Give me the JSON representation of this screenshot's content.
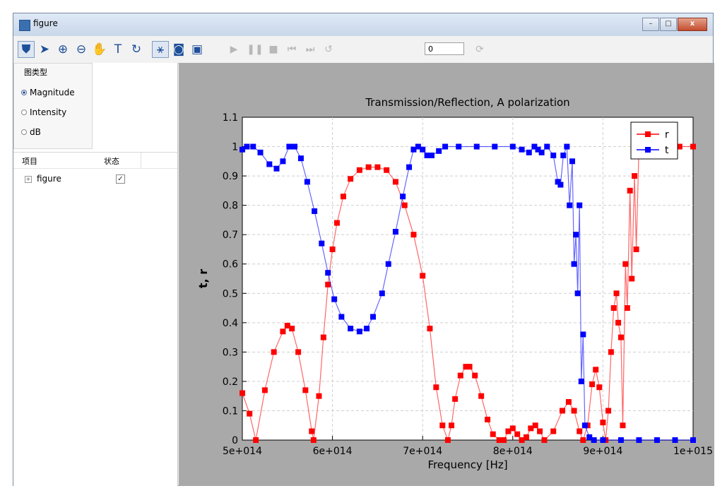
{
  "window": {
    "title": "figure",
    "buttons": {
      "minimize": "–",
      "maximize": "□",
      "close": "x"
    }
  },
  "toolbar": {
    "tools": [
      {
        "name": "select-mode-icon",
        "glyph": "⛊",
        "selected": true,
        "enabled": true
      },
      {
        "name": "pointer-icon",
        "glyph": "➤",
        "selected": false,
        "enabled": true
      },
      {
        "name": "zoom-in-icon",
        "glyph": "⊕",
        "selected": false,
        "enabled": true
      },
      {
        "name": "zoom-out-icon",
        "glyph": "⊖",
        "selected": false,
        "enabled": true
      },
      {
        "name": "pan-hand-icon",
        "glyph": "✋",
        "selected": false,
        "enabled": true
      },
      {
        "name": "text-tool-icon",
        "glyph": "T",
        "selected": false,
        "enabled": true
      },
      {
        "name": "rotate-icon",
        "glyph": "↻",
        "selected": false,
        "enabled": true
      },
      {
        "name": "data-cursor-icon",
        "glyph": "⚹",
        "selected": true,
        "enabled": true
      },
      {
        "name": "camera-icon",
        "glyph": "◙",
        "selected": false,
        "enabled": true
      },
      {
        "name": "export-icon",
        "glyph": "▣",
        "selected": false,
        "enabled": true
      },
      {
        "name": "play-icon",
        "glyph": "▶",
        "selected": false,
        "enabled": false
      },
      {
        "name": "pause-icon",
        "glyph": "❚❚",
        "selected": false,
        "enabled": false
      },
      {
        "name": "stop-icon",
        "glyph": "■",
        "selected": false,
        "enabled": false
      },
      {
        "name": "first-frame-icon",
        "glyph": "⏮",
        "selected": false,
        "enabled": false
      },
      {
        "name": "last-frame-icon",
        "glyph": "⏭",
        "selected": false,
        "enabled": false
      },
      {
        "name": "loop-icon",
        "glyph": "↺",
        "selected": false,
        "enabled": false
      }
    ],
    "frame_value": "0",
    "refresh_icon": "⟳"
  },
  "panel": {
    "plot_type_title": "图类型",
    "options": [
      {
        "label": "Magnitude",
        "selected": true
      },
      {
        "label": "Intensity",
        "selected": false
      },
      {
        "label": "dB",
        "selected": false
      }
    ],
    "tree_headers": {
      "item": "项目",
      "status": "状态"
    },
    "tree_rows": [
      {
        "label": "figure",
        "checked": true
      }
    ]
  },
  "colors": {
    "r": "#ff0000",
    "t": "#0000ff",
    "plot_bg": "#a9a9a9"
  },
  "chart_data": {
    "type": "scatter",
    "title": "Transmission/Reflection, A polarization",
    "xlabel": "Frequency [Hz]",
    "ylabel": "t, r",
    "xlim": [
      500000000000000.0,
      1000000000000000.0
    ],
    "ylim": [
      0,
      1.1
    ],
    "xticks": [
      "5e+014",
      "6e+014",
      "7e+014",
      "8e+014",
      "9e+014",
      "1e+015"
    ],
    "yticks": [
      "0",
      "0.1",
      "0.2",
      "0.3",
      "0.4",
      "0.5",
      "0.6",
      "0.7",
      "0.8",
      "0.9",
      "1",
      "1.1"
    ],
    "grid": true,
    "legend": "top-right",
    "series": [
      {
        "name": "r",
        "color": "#ff0000",
        "points": [
          [
            500000000000000.0,
            0.16
          ],
          [
            508000000000000.0,
            0.09
          ],
          [
            515000000000000.0,
            0.0
          ],
          [
            525000000000000.0,
            0.17
          ],
          [
            535000000000000.0,
            0.3
          ],
          [
            545000000000000.0,
            0.37
          ],
          [
            550000000000000.0,
            0.39
          ],
          [
            555000000000000.0,
            0.38
          ],
          [
            562000000000000.0,
            0.3
          ],
          [
            570000000000000.0,
            0.17
          ],
          [
            577000000000000.0,
            0.03
          ],
          [
            579000000000000.0,
            0.0
          ],
          [
            585000000000000.0,
            0.15
          ],
          [
            590000000000000.0,
            0.35
          ],
          [
            595000000000000.0,
            0.53
          ],
          [
            600000000000000.0,
            0.65
          ],
          [
            605000000000000.0,
            0.74
          ],
          [
            612000000000000.0,
            0.83
          ],
          [
            620000000000000.0,
            0.89
          ],
          [
            630000000000000.0,
            0.92
          ],
          [
            640000000000000.0,
            0.93
          ],
          [
            650000000000000.0,
            0.93
          ],
          [
            660000000000000.0,
            0.92
          ],
          [
            670000000000000.0,
            0.88
          ],
          [
            680000000000000.0,
            0.8
          ],
          [
            690000000000000.0,
            0.7
          ],
          [
            700000000000000.0,
            0.56
          ],
          [
            708000000000000.0,
            0.38
          ],
          [
            715000000000000.0,
            0.18
          ],
          [
            722000000000000.0,
            0.05
          ],
          [
            728000000000000.0,
            0.0
          ],
          [
            732000000000000.0,
            0.05
          ],
          [
            736000000000000.0,
            0.14
          ],
          [
            742000000000000.0,
            0.22
          ],
          [
            748000000000000.0,
            0.25
          ],
          [
            752000000000000.0,
            0.25
          ],
          [
            758000000000000.0,
            0.22
          ],
          [
            765000000000000.0,
            0.15
          ],
          [
            772000000000000.0,
            0.07
          ],
          [
            778000000000000.0,
            0.02
          ],
          [
            785000000000000.0,
            0.0
          ],
          [
            790000000000000.0,
            0.0
          ],
          [
            795000000000000.0,
            0.03
          ],
          [
            800000000000000.0,
            0.04
          ],
          [
            805000000000000.0,
            0.02
          ],
          [
            810000000000000.0,
            0.0
          ],
          [
            815000000000000.0,
            0.01
          ],
          [
            820000000000000.0,
            0.04
          ],
          [
            825000000000000.0,
            0.05
          ],
          [
            830000000000000.0,
            0.03
          ],
          [
            835000000000000.0,
            0.0
          ],
          [
            845000000000000.0,
            0.03
          ],
          [
            855000000000000.0,
            0.1
          ],
          [
            862000000000000.0,
            0.13
          ],
          [
            868000000000000.0,
            0.1
          ],
          [
            874000000000000.0,
            0.03
          ],
          [
            878000000000000.0,
            0.0
          ],
          [
            883000000000000.0,
            0.05
          ],
          [
            888000000000000.0,
            0.19
          ],
          [
            892000000000000.0,
            0.24
          ],
          [
            896000000000000.0,
            0.18
          ],
          [
            900000000000000.0,
            0.06
          ],
          [
            903000000000000.0,
            0.0
          ],
          [
            906000000000000.0,
            0.1
          ],
          [
            909000000000000.0,
            0.3
          ],
          [
            912000000000000.0,
            0.45
          ],
          [
            915000000000000.0,
            0.5
          ],
          [
            917000000000000.0,
            0.4
          ],
          [
            920000000000000.0,
            0.35
          ],
          [
            922000000000000.0,
            0.05
          ],
          [
            925000000000000.0,
            0.6
          ],
          [
            927000000000000.0,
            0.45
          ],
          [
            930000000000000.0,
            0.85
          ],
          [
            932000000000000.0,
            0.55
          ],
          [
            935000000000000.0,
            0.9
          ],
          [
            937000000000000.0,
            0.65
          ],
          [
            940000000000000.0,
            1.0
          ],
          [
            945000000000000.0,
            1.0
          ],
          [
            955000000000000.0,
            1.0
          ],
          [
            970000000000000.0,
            1.0
          ],
          [
            985000000000000.0,
            1.0
          ],
          [
            1000000000000000.0,
            1.0
          ]
        ]
      },
      {
        "name": "t",
        "color": "#0000ff",
        "points": [
          [
            500000000000000.0,
            0.99
          ],
          [
            505000000000000.0,
            1.0
          ],
          [
            512000000000000.0,
            1.0
          ],
          [
            520000000000000.0,
            0.98
          ],
          [
            530000000000000.0,
            0.94
          ],
          [
            538000000000000.0,
            0.925
          ],
          [
            545000000000000.0,
            0.95
          ],
          [
            552000000000000.0,
            1.0
          ],
          [
            558000000000000.0,
            1.0
          ],
          [
            565000000000000.0,
            0.96
          ],
          [
            572000000000000.0,
            0.88
          ],
          [
            580000000000000.0,
            0.78
          ],
          [
            588000000000000.0,
            0.67
          ],
          [
            595000000000000.0,
            0.57
          ],
          [
            602000000000000.0,
            0.48
          ],
          [
            610000000000000.0,
            0.42
          ],
          [
            620000000000000.0,
            0.38
          ],
          [
            630000000000000.0,
            0.37
          ],
          [
            638000000000000.0,
            0.38
          ],
          [
            645000000000000.0,
            0.42
          ],
          [
            655000000000000.0,
            0.5
          ],
          [
            662000000000000.0,
            0.6
          ],
          [
            670000000000000.0,
            0.71
          ],
          [
            678000000000000.0,
            0.83
          ],
          [
            685000000000000.0,
            0.93
          ],
          [
            690000000000000.0,
            0.99
          ],
          [
            695000000000000.0,
            1.0
          ],
          [
            700000000000000.0,
            0.99
          ],
          [
            705000000000000.0,
            0.97
          ],
          [
            710000000000000.0,
            0.97
          ],
          [
            718000000000000.0,
            0.985
          ],
          [
            725000000000000.0,
            1.0
          ],
          [
            740000000000000.0,
            1.0
          ],
          [
            760000000000000.0,
            1.0
          ],
          [
            780000000000000.0,
            1.0
          ],
          [
            800000000000000.0,
            1.0
          ],
          [
            810000000000000.0,
            0.99
          ],
          [
            818000000000000.0,
            0.98
          ],
          [
            824000000000000.0,
            1.0
          ],
          [
            828000000000000.0,
            0.99
          ],
          [
            832000000000000.0,
            0.98
          ],
          [
            838000000000000.0,
            1.0
          ],
          [
            845000000000000.0,
            0.97
          ],
          [
            850000000000000.0,
            0.88
          ],
          [
            853000000000000.0,
            0.87
          ],
          [
            856000000000000.0,
            0.97
          ],
          [
            860000000000000.0,
            1.0
          ],
          [
            863000000000000.0,
            0.8
          ],
          [
            866000000000000.0,
            0.95
          ],
          [
            868000000000000.0,
            0.6
          ],
          [
            870000000000000.0,
            0.7
          ],
          [
            872000000000000.0,
            0.5
          ],
          [
            874000000000000.0,
            0.8
          ],
          [
            876000000000000.0,
            0.2
          ],
          [
            878000000000000.0,
            0.36
          ],
          [
            880000000000000.0,
            0.05
          ],
          [
            885000000000000.0,
            0.01
          ],
          [
            890000000000000.0,
            0.0
          ],
          [
            900000000000000.0,
            0.0
          ],
          [
            920000000000000.0,
            0.0
          ],
          [
            940000000000000.0,
            0.0
          ],
          [
            960000000000000.0,
            0.0
          ],
          [
            980000000000000.0,
            0.0
          ],
          [
            1000000000000000.0,
            0.0
          ]
        ]
      }
    ]
  }
}
